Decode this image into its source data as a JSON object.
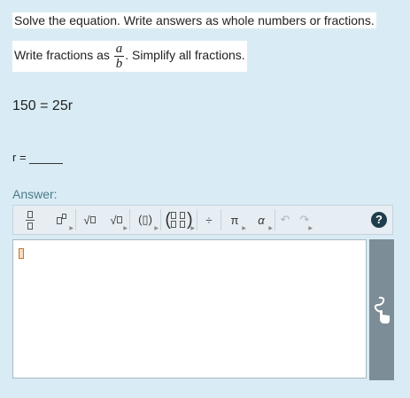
{
  "instructions": {
    "line1": "Solve the equation.  Write answers as whole numbers or fractions.",
    "line2_prefix": "Write fractions as",
    "frac_num": "a",
    "frac_den": "b",
    "line2_suffix": ". Simplify all fractions."
  },
  "equation": "150 = 25r",
  "answer_prompt": "r =",
  "answer_label": "Answer:",
  "toolbar": {
    "fraction_icon": "fraction-icon",
    "exponent_icon": "superscript-icon",
    "sqrt_label": "√",
    "nthroot_label": "√",
    "paren_label": "(▯)",
    "matrix_label": "matrix",
    "divide_label": "÷",
    "pi_label": "π",
    "alpha_label": "α",
    "undo_label": "↶",
    "redo_label": "↷",
    "help_label": "?"
  },
  "editor": {
    "value": ""
  },
  "handwriting_icon": "handwriting-icon"
}
